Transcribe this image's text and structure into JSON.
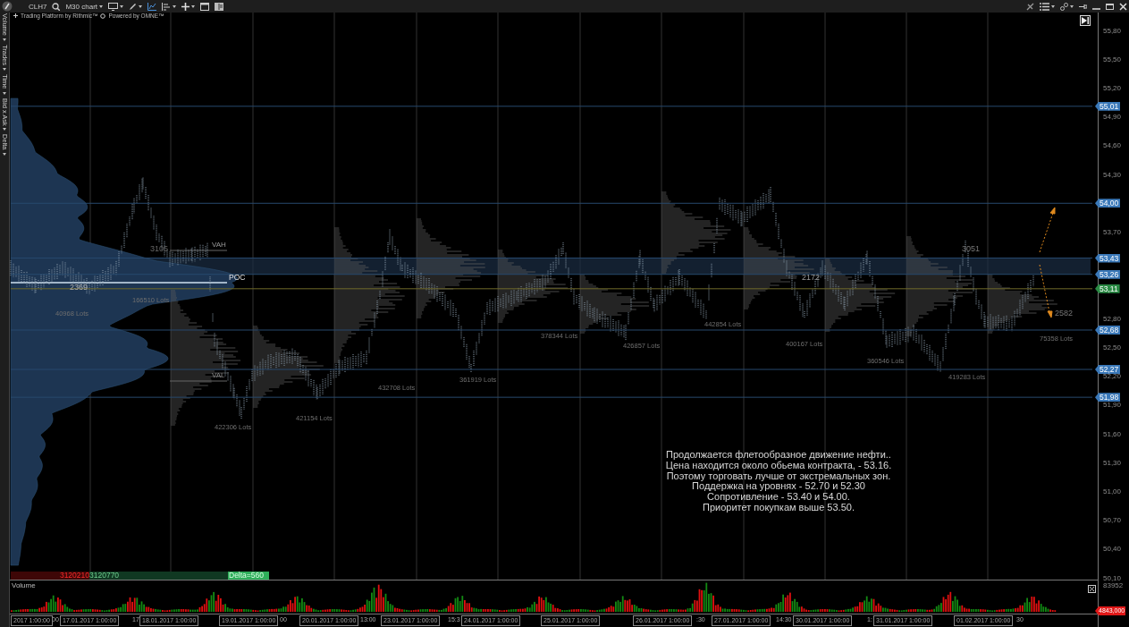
{
  "toolbar": {
    "symbol": "CLH7",
    "chart_type": "M30 chart",
    "branding": [
      "Trading Platform by Rithmic™",
      "Powered by OMNE™"
    ]
  },
  "side_tabs": [
    {
      "label": "Volume"
    },
    {
      "label": "Trades"
    },
    {
      "label": "Time"
    },
    {
      "label": "Bid x Ask"
    },
    {
      "label": "Delta"
    }
  ],
  "chart": {
    "profile_labels": [
      "VAH",
      "POC",
      "VAL",
      "3105",
      "2369",
      "2172",
      "3051",
      "2582"
    ],
    "lots_labels": [
      "40968 Lots",
      "166510 Lots",
      "422306 Lots",
      "421154 Lots",
      "432708 Lots",
      "361919 Lots",
      "378344 Lots",
      "426857 Lots",
      "442854 Lots",
      "400167 Lots",
      "360546 Lots",
      "419283 Lots",
      "75358 Lots"
    ],
    "annotation": [
      "Продолжается флетообразное движение нефти..",
      "Цена находится около обьема контракта, - 53.16.",
      "Поэтому торговать лучше от экстремальных зон.",
      "Поддержка на уровнях - 52.70 и 52.30",
      "Сопротивление - 53.40 и 54.00.",
      "Приоритет покупкам выше 53.50."
    ],
    "delta": {
      "sell": "3120210",
      "buy": "3120770",
      "delta": "Delta=560"
    }
  },
  "price_axis": {
    "ticks": [
      "55,80",
      "55,50",
      "55,20",
      "54,90",
      "54,60",
      "54,30",
      "53,70",
      "52,80",
      "52,50",
      "52,20",
      "51,90",
      "51,60",
      "51,30",
      "51,00",
      "50,70",
      "50,40",
      "50,10"
    ],
    "levels": [
      {
        "price": "55,01",
        "kind": "level",
        "color": "#3a78b8"
      },
      {
        "price": "54,00",
        "kind": "level",
        "color": "#3a78b8"
      },
      {
        "price": "53,43",
        "kind": "level",
        "color": "#3a78b8"
      },
      {
        "price": "53,26",
        "kind": "level",
        "color": "#3a78b8"
      },
      {
        "price": "53,11",
        "kind": "last",
        "color": "#2a8a44"
      },
      {
        "price": "52,68",
        "kind": "level",
        "color": "#3a78b8"
      },
      {
        "price": "52,27",
        "kind": "level",
        "color": "#3a78b8"
      },
      {
        "price": "51,98",
        "kind": "level",
        "color": "#3a78b8"
      }
    ]
  },
  "volume": {
    "title": "Volume",
    "max": "83952",
    "last": "4843,000"
  },
  "time_axis": {
    "dates": [
      "2017 1:00:00",
      "17.01.2017 1:00:00",
      "18.01.2017 1:00:00",
      "19.01.2017 1:00:00",
      "20.01.2017 1:00:00",
      "23.01.2017 1:00:00",
      "24.01.2017 1:00:00",
      "25.01.2017 1:00:00",
      "26.01.2017 1:00:00",
      "27.01.2017 1:00:00",
      "30.01.2017 1:00:00",
      "31.01.2017 1:00:00",
      "01.02.2017 1:00:00"
    ],
    "fragments": [
      "00",
      "17",
      "00",
      "13:00",
      "15:3",
      ":30",
      "14:30",
      "1:",
      "30"
    ]
  }
}
